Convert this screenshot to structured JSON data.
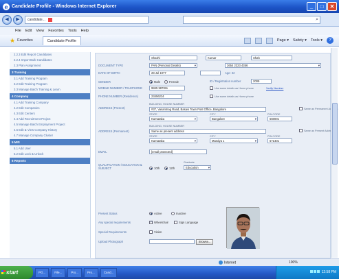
{
  "window": {
    "title": "Candidate Profile - Windows Internet Explorer"
  },
  "addressbar": {
    "url": "candidate...",
    "search_placeholder": ""
  },
  "menu": [
    "File",
    "Edit",
    "View",
    "Favorites",
    "Tools",
    "Help"
  ],
  "favorites": {
    "label": "Favorites",
    "tab_title": "Candidate Profile"
  },
  "commandbar": {
    "page": "Page ▾",
    "safety": "Safety ▾",
    "tools": "Tools ▾"
  },
  "sidebar": {
    "top_items": [
      "2.2.3 Edit Report Candidates",
      "2.2.4 Import Bulk Candidates",
      "2.3 Plan Assignment"
    ],
    "sections": [
      {
        "title": "3 Training",
        "items": [
          "3.1 Add Training Program",
          "3.2 Edit Training Program",
          "3.3 Manage Batch Training & Learn"
        ]
      },
      {
        "title": "4 Company",
        "items": [
          "4.1 Add Training Company",
          "4.2 Edit Companies",
          "4.3 Edit Centers",
          "4.4 Add Recruitment Project",
          "4.5 Manage Batch Employment Project",
          "4.6 Edit & View Company History",
          "4.7 Manage Company Cluster"
        ]
      },
      {
        "title": "5 MIS",
        "items": [
          "5.1 Add User",
          "5.2 Edit Lock & Unlock"
        ]
      },
      {
        "title": "6 Reports",
        "items": []
      }
    ]
  },
  "form": {
    "name_placeholders": [
      "Shashi",
      "Kumar",
      "Shah"
    ],
    "document_type_label": "DOCUMENT TYPE",
    "document_type_value": "PAN (Personal Details)",
    "id_number_label": "",
    "id_number_value": "2654 2323 4356",
    "date_of_birth_label": "DATE OF BIRTH",
    "date_of_birth_value": "28 Jul 1977",
    "age_label": "Age: 32",
    "gender_label": "GENDER",
    "gender_options": [
      "Male",
      "Female"
    ],
    "enrolment_label": "ID / Registration number",
    "enrolment_value": "2009",
    "mobile_label": "MOBILE NUMBER / TELEPHONE",
    "mobile_value": "9845 587811",
    "mobile_check_label": "Use same details as Home phone",
    "verify_link": "Verify Number",
    "phone_label": "PHONE NUMBER (Residence)",
    "phone_value": "23456234",
    "phone_check_label": "Use same details as Home phone",
    "address_label": "ADDRESS (Present)",
    "address_sub": "BUILDING, HOUSE NUMBER",
    "address_value": "#37, Vasantnag Road, Basavi Town Post Office, Bangalore",
    "present_check_label": "Same as Permanent Address",
    "state_label": "STATE",
    "district_label": "CITY",
    "pincode_label": "PIN CODE",
    "state_value": "Karnataka",
    "district_value": "Bangalore",
    "pincode_value": "560001",
    "perm_address_label": "ADDRESS (Permanent)",
    "perm_address_value": "Same as present address",
    "perm_check_label": "Same as Present Address",
    "perm_state_value": "Karnataka",
    "perm_district_value": "Mandya 1",
    "perm_pincode_value": "571401",
    "email_label": "EMAIL",
    "email_value": "[email protected]",
    "education_label": "QUALIFICATION / EDUCATION & SUBJECT",
    "education_options": [
      "10th",
      "12th"
    ],
    "education_sub": "Graduate",
    "education_value": "Education",
    "status_label": "Present Status",
    "status_options": [
      "Active",
      "Inactive"
    ],
    "disability_label": "Any special requirements",
    "disability_options": [
      "Wheelchair",
      "Sign Language"
    ],
    "special_label": "Special Requirements",
    "special_option": "Vision",
    "photo_label": "Upload Photograph",
    "browse_label": "Browse..."
  },
  "statusbar": {
    "zone": "Internet",
    "zoom": "100%"
  },
  "taskbar": {
    "start": "start",
    "items": [
      "PG...",
      "File...",
      "Pro...",
      "Pro...",
      "Cand..."
    ],
    "tray_time": "12:58 PM"
  }
}
